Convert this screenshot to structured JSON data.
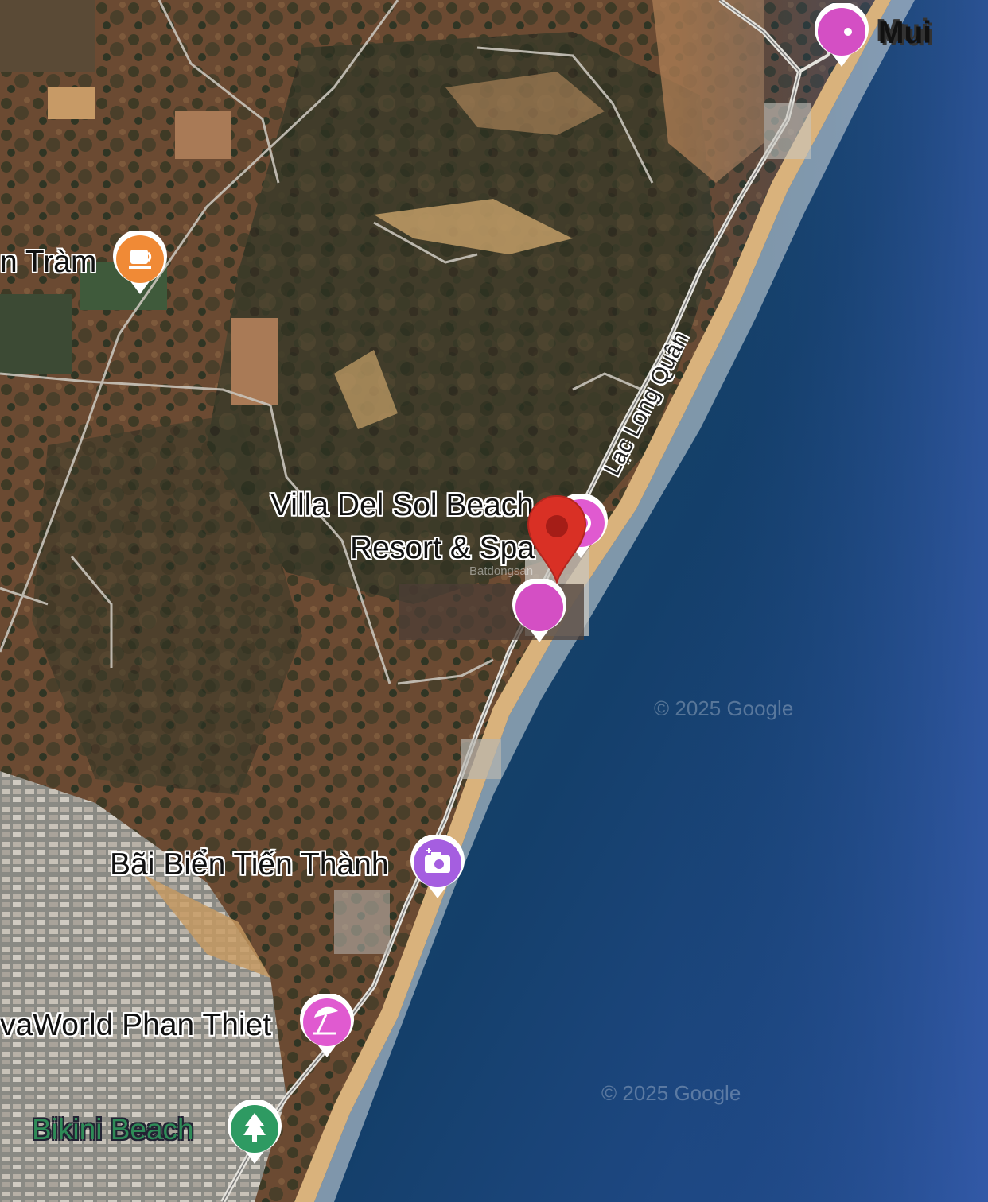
{
  "map": {
    "type": "satellite",
    "attribution": "© 2025 Google"
  },
  "labels": {
    "place_top_left": "n Tràm",
    "villa_line1": "Villa Del Sol Beach",
    "villa_line2": "Resort & Spa",
    "road": "Lạc Long Quân",
    "tien_thanh": "Bãi Biển Tiến Thành",
    "novaworld": "vaWorld Phan Thiet",
    "bikini": "Bikini Beach",
    "top_right_partial": "Mui",
    "watermark_small": "Batdongsan"
  },
  "pins": {
    "cafe": {
      "icon": "coffee-cup-icon",
      "color": "#f08a36"
    },
    "villa": {
      "icon": "resort-icon",
      "color": "#e05ad0"
    },
    "selected": {
      "icon": "red-location-pin-icon",
      "color": "#d93025"
    },
    "pink_center": {
      "icon": "pink-dot-icon",
      "color": "#d44fc4"
    },
    "top_right": {
      "icon": "pink-dot-icon",
      "color": "#d44fc4"
    },
    "tien_thanh": {
      "icon": "camera-icon",
      "color": "#a55ee0"
    },
    "novaworld": {
      "icon": "beach-umbrella-icon",
      "color": "#e05ad0"
    },
    "bikini": {
      "icon": "tree-icon",
      "color": "#2e9a62"
    }
  }
}
